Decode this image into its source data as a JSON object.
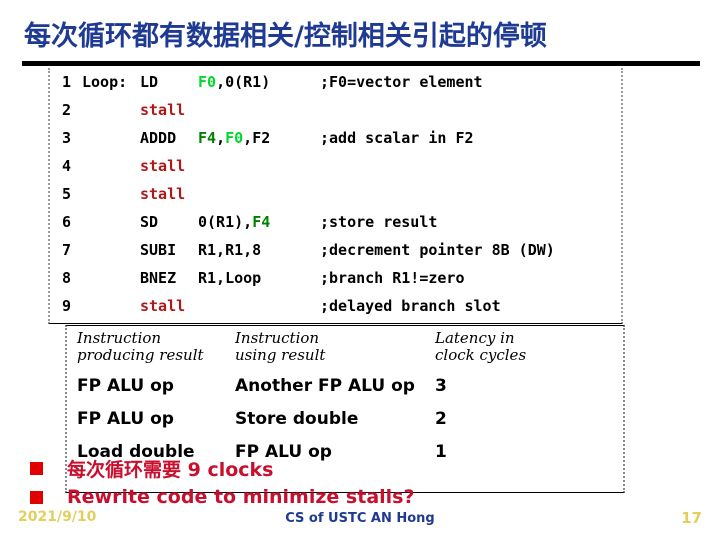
{
  "slide": {
    "title": "每次循环都有数据相关/控制相关引起的停顿"
  },
  "code": {
    "lines": [
      {
        "num": "1",
        "label": "Loop:",
        "op": "LD",
        "args": [
          {
            "t": "F0",
            "c": "green-bright"
          },
          {
            "t": ",",
            "c": "black"
          },
          {
            "t": "0(R1)",
            "c": "black"
          }
        ],
        "comment": ";F0=vector element"
      },
      {
        "num": "2",
        "label": "",
        "op": "stall",
        "args": [],
        "comment": ""
      },
      {
        "num": "3",
        "label": "",
        "op": "ADDD",
        "args": [
          {
            "t": "F4",
            "c": "green-dark"
          },
          {
            "t": ",",
            "c": "black"
          },
          {
            "t": "F0",
            "c": "green-bright"
          },
          {
            "t": ",",
            "c": "black"
          },
          {
            "t": "F2",
            "c": "black"
          }
        ],
        "comment": ";add scalar in F2"
      },
      {
        "num": "4",
        "label": "",
        "op": "stall",
        "args": [],
        "comment": ""
      },
      {
        "num": "5",
        "label": "",
        "op": "stall",
        "args": [],
        "comment": ""
      },
      {
        "num": "6",
        "label": "",
        "op": "SD",
        "args": [
          {
            "t": "0(R1)",
            "c": "black"
          },
          {
            "t": ",",
            "c": "black"
          },
          {
            "t": "F4",
            "c": "green-dark"
          }
        ],
        "comment": ";store result"
      },
      {
        "num": "7",
        "label": "",
        "op": "SUBI",
        "args": [
          {
            "t": "R1,R1,8",
            "c": "black"
          }
        ],
        "comment": ";decrement pointer 8B (DW)"
      },
      {
        "num": "8",
        "label": "",
        "op": "BNEZ",
        "args": [
          {
            "t": "R1,Loop",
            "c": "black"
          }
        ],
        "comment": ";branch R1!=zero"
      },
      {
        "num": "9",
        "label": "",
        "op": "stall",
        "args": [],
        "comment": ";delayed branch slot"
      }
    ]
  },
  "latency_table": {
    "headers": [
      {
        "line1": "Instruction",
        "line2": "producing result"
      },
      {
        "line1": "Instruction",
        "line2": "using result"
      },
      {
        "line1": "Latency in",
        "line2": "clock cycles"
      }
    ],
    "rows": [
      {
        "producing": "FP ALU op",
        "using": "Another FP ALU op",
        "latency": "3"
      },
      {
        "producing": "FP ALU op",
        "using": "Store double",
        "latency": "2"
      },
      {
        "producing": "Load double",
        "using": "FP ALU op",
        "latency": "1"
      }
    ]
  },
  "bullets": [
    {
      "text": "每次循环需要 9 clocks"
    },
    {
      "text": "Rewrite code to minimize stalls?"
    }
  ],
  "footer": {
    "date": "2021/9/10",
    "center": "CS of USTC AN Hong",
    "page": "17"
  },
  "colors": {
    "title": "#1F3A93",
    "stall": "#AE1818",
    "register_highlight": "#00D82B",
    "register_dark": "#008000",
    "bullet_marker": "#E00000",
    "bullet_text": "#C8102E",
    "footer_accent": "#E3CE5E"
  }
}
